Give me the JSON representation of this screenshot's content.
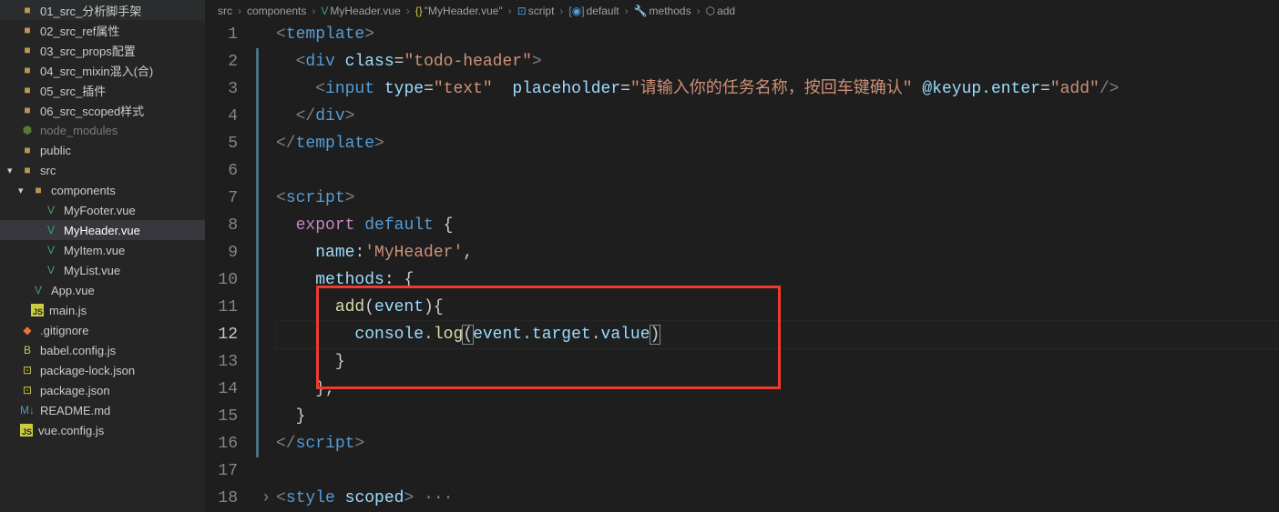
{
  "sidebar": {
    "items": [
      {
        "label": "01_src_分析脚手架",
        "type": "folder",
        "indent": 0,
        "iconClass": "ic-folder",
        "icon": "■"
      },
      {
        "label": "02_src_ref属性",
        "type": "folder",
        "indent": 0,
        "iconClass": "ic-folder",
        "icon": "■"
      },
      {
        "label": "03_src_props配置",
        "type": "folder",
        "indent": 0,
        "iconClass": "ic-folder",
        "icon": "■"
      },
      {
        "label": "04_src_mixin混入(合)",
        "type": "folder",
        "indent": 0,
        "iconClass": "ic-folder",
        "icon": "■"
      },
      {
        "label": "05_src_插件",
        "type": "folder",
        "indent": 0,
        "iconClass": "ic-folder",
        "icon": "■"
      },
      {
        "label": "06_src_scoped样式",
        "type": "folder",
        "indent": 0,
        "iconClass": "ic-folder",
        "icon": "■"
      },
      {
        "label": "node_modules",
        "type": "folder",
        "indent": 0,
        "iconClass": "ic-node",
        "icon": "⬢",
        "dim": true
      },
      {
        "label": "public",
        "type": "folder",
        "indent": 0,
        "iconClass": "ic-folder",
        "icon": "■"
      },
      {
        "label": "src",
        "type": "folder",
        "indent": 0,
        "iconClass": "ic-folder",
        "icon": "■",
        "chevron": "▾"
      },
      {
        "label": "components",
        "type": "folder",
        "indent": 1,
        "iconClass": "ic-folder",
        "icon": "■",
        "chevron": "▾"
      },
      {
        "label": "MyFooter.vue",
        "type": "vue",
        "indent": 2,
        "iconClass": "ic-vue",
        "icon": "V"
      },
      {
        "label": "MyHeader.vue",
        "type": "vue",
        "indent": 2,
        "iconClass": "ic-vue",
        "icon": "V",
        "selected": true
      },
      {
        "label": "MyItem.vue",
        "type": "vue",
        "indent": 2,
        "iconClass": "ic-vue",
        "icon": "V"
      },
      {
        "label": "MyList.vue",
        "type": "vue",
        "indent": 2,
        "iconClass": "ic-vue",
        "icon": "V"
      },
      {
        "label": "App.vue",
        "type": "vue",
        "indent": 1,
        "iconClass": "ic-vue",
        "icon": "V"
      },
      {
        "label": "main.js",
        "type": "js",
        "indent": 1,
        "iconClass": "ic-js-box",
        "icon": "JS"
      },
      {
        "label": ".gitignore",
        "type": "git",
        "indent": 0,
        "iconClass": "ic-git",
        "icon": "◆"
      },
      {
        "label": "babel.config.js",
        "type": "babel",
        "indent": 0,
        "iconClass": "ic-babel",
        "icon": "B"
      },
      {
        "label": "package-lock.json",
        "type": "json",
        "indent": 0,
        "iconClass": "ic-json",
        "icon": "⊡"
      },
      {
        "label": "package.json",
        "type": "json",
        "indent": 0,
        "iconClass": "ic-json",
        "icon": "⊡"
      },
      {
        "label": "README.md",
        "type": "md",
        "indent": 0,
        "iconClass": "ic-md",
        "icon": "M↓"
      },
      {
        "label": "vue.config.js",
        "type": "js",
        "indent": 0,
        "iconClass": "ic-js-box",
        "icon": "JS"
      }
    ]
  },
  "breadcrumb": [
    {
      "label": "src",
      "icon": ""
    },
    {
      "label": "components",
      "icon": ""
    },
    {
      "label": "MyHeader.vue",
      "icon": "V",
      "iconClass": "ic-vue"
    },
    {
      "label": "\"MyHeader.vue\"",
      "icon": "{}",
      "iconClass": "ic-json"
    },
    {
      "label": "script",
      "icon": "⊡",
      "iconClass": "tok-tag"
    },
    {
      "label": "default",
      "icon": "[◉]",
      "iconClass": "tok-tag"
    },
    {
      "label": "methods",
      "icon": "🔧",
      "iconClass": ""
    },
    {
      "label": "add",
      "icon": "⬡",
      "iconClass": ""
    }
  ],
  "code": {
    "currentLine": 12,
    "lines": [
      1,
      2,
      3,
      4,
      5,
      6,
      7,
      8,
      9,
      10,
      11,
      12,
      13,
      14,
      15,
      16,
      17,
      18
    ],
    "t": {
      "template": "template",
      "div": "div",
      "class": "class",
      "todo": "\"todo-header\"",
      "input": "input",
      "type": "type",
      "text": "\"text\"",
      "placeholder": "placeholder",
      "ph": "\"请输入你的任务名称，按回车键确认\"",
      "keyup": "@keyup.enter",
      "add": "\"add\"",
      "script": "script",
      "export": "export",
      "default": "default",
      "name": "name",
      "myheader": "'MyHeader'",
      "methods": "methods",
      "addfn": "add",
      "event": "event",
      "console": "console",
      "log": "log",
      "target": "target",
      "value": "value",
      "style": "style",
      "scoped": "scoped"
    }
  }
}
